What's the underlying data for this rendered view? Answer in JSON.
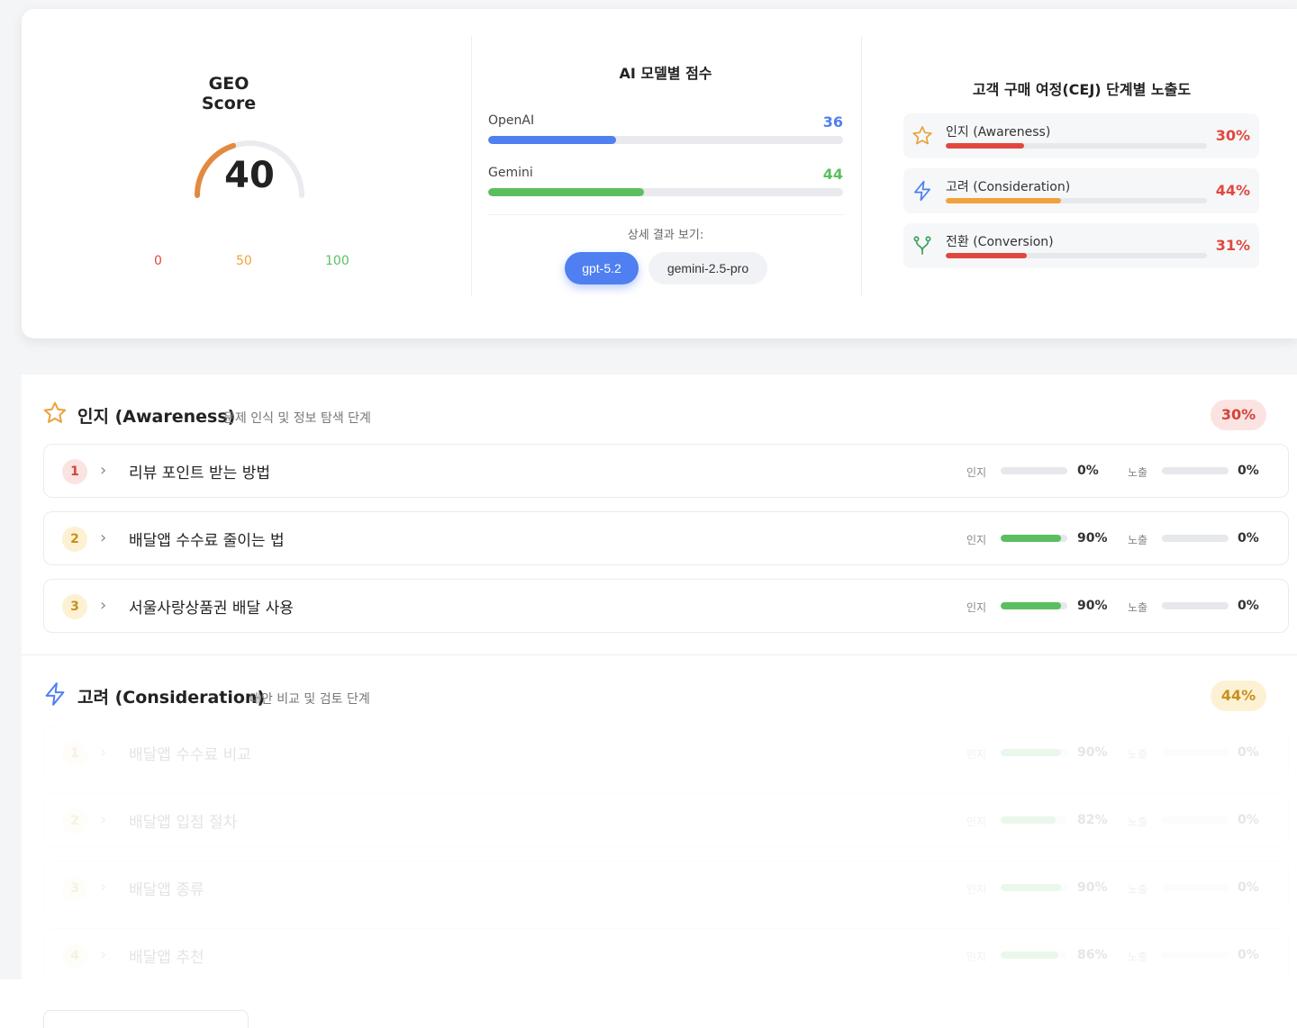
{
  "geo": {
    "title": "GEO Score",
    "value": "40",
    "score": 40,
    "max": 100,
    "ticks": [
      "0",
      "50",
      "100"
    ]
  },
  "models": {
    "title": "AI 모델별 점수",
    "rows": [
      {
        "name": "OpenAI",
        "value": "36",
        "score": 36,
        "color": "#4f7ff0"
      },
      {
        "name": "Gemini",
        "value": "44",
        "score": 44,
        "color": "#5bbf5f"
      }
    ],
    "detail_label": "상세 결과 보기:",
    "buttons": [
      "gpt-5.2",
      "gemini-2.5-pro"
    ]
  },
  "cej": {
    "title": "고객 구매 여정(CEJ) 단계별 노출도",
    "rows": [
      {
        "icon": "star-icon",
        "label": "인지 (Awareness)",
        "pct": "30%",
        "level": 30,
        "color": "#e0483f"
      },
      {
        "icon": "lightning-icon",
        "label": "고려 (Consideration)",
        "pct": "44%",
        "level": 44,
        "color": "#f2a23c"
      },
      {
        "icon": "fork-icon",
        "label": "전환 (Conversion)",
        "pct": "31%",
        "level": 31,
        "color": "#e0483f"
      }
    ]
  },
  "stages": [
    {
      "icon": "star-icon",
      "name": "인지 (Awareness)",
      "desc": "문제 인식 및 정보 탐색 단계",
      "pct": "30%",
      "questions": [
        {
          "num": "1",
          "text": "리뷰 포인트 받는 방법",
          "recog_label": "인지",
          "recog_pct": "0%",
          "recog": 0,
          "expo_label": "노출",
          "expo_pct": "0%",
          "expo": 0
        },
        {
          "num": "2",
          "text": "배달앱 수수료 줄이는 법",
          "recog_label": "인지",
          "recog_pct": "90%",
          "recog": 90,
          "expo_label": "노출",
          "expo_pct": "0%",
          "expo": 0
        },
        {
          "num": "3",
          "text": "서울사랑상품권 배달 사용",
          "recog_label": "인지",
          "recog_pct": "90%",
          "recog": 90,
          "expo_label": "노출",
          "expo_pct": "0%",
          "expo": 0
        }
      ]
    },
    {
      "icon": "lightning-icon",
      "name": "고려 (Consideration)",
      "desc": "대안 비교 및 검토 단계",
      "pct": "44%",
      "questions": [
        {
          "num": "1",
          "text": "배달앱 수수료 비교",
          "recog_label": "인지",
          "recog_pct": "90%",
          "recog": 90,
          "expo_label": "노출",
          "expo_pct": "0%",
          "expo": 0
        },
        {
          "num": "2",
          "text": "배달앱 입점 절차",
          "recog_label": "인지",
          "recog_pct": "82%",
          "recog": 82,
          "expo_label": "노출",
          "expo_pct": "0%",
          "expo": 0
        },
        {
          "num": "3",
          "text": "배달앱 종류",
          "recog_label": "인지",
          "recog_pct": "90%",
          "recog": 90,
          "expo_label": "노출",
          "expo_pct": "0%",
          "expo": 0
        },
        {
          "num": "4",
          "text": "배달앱 추천",
          "recog_label": "인지",
          "recog_pct": "86%",
          "recog": 86,
          "expo_label": "노출",
          "expo_pct": "0%",
          "expo": 0
        }
      ]
    }
  ],
  "colors": {
    "accent_blue": "#4f7ff0",
    "green": "#5bbf5f",
    "orange": "#f2a23c",
    "red": "#e0483f",
    "gauge_orange": "#e28a3f"
  }
}
